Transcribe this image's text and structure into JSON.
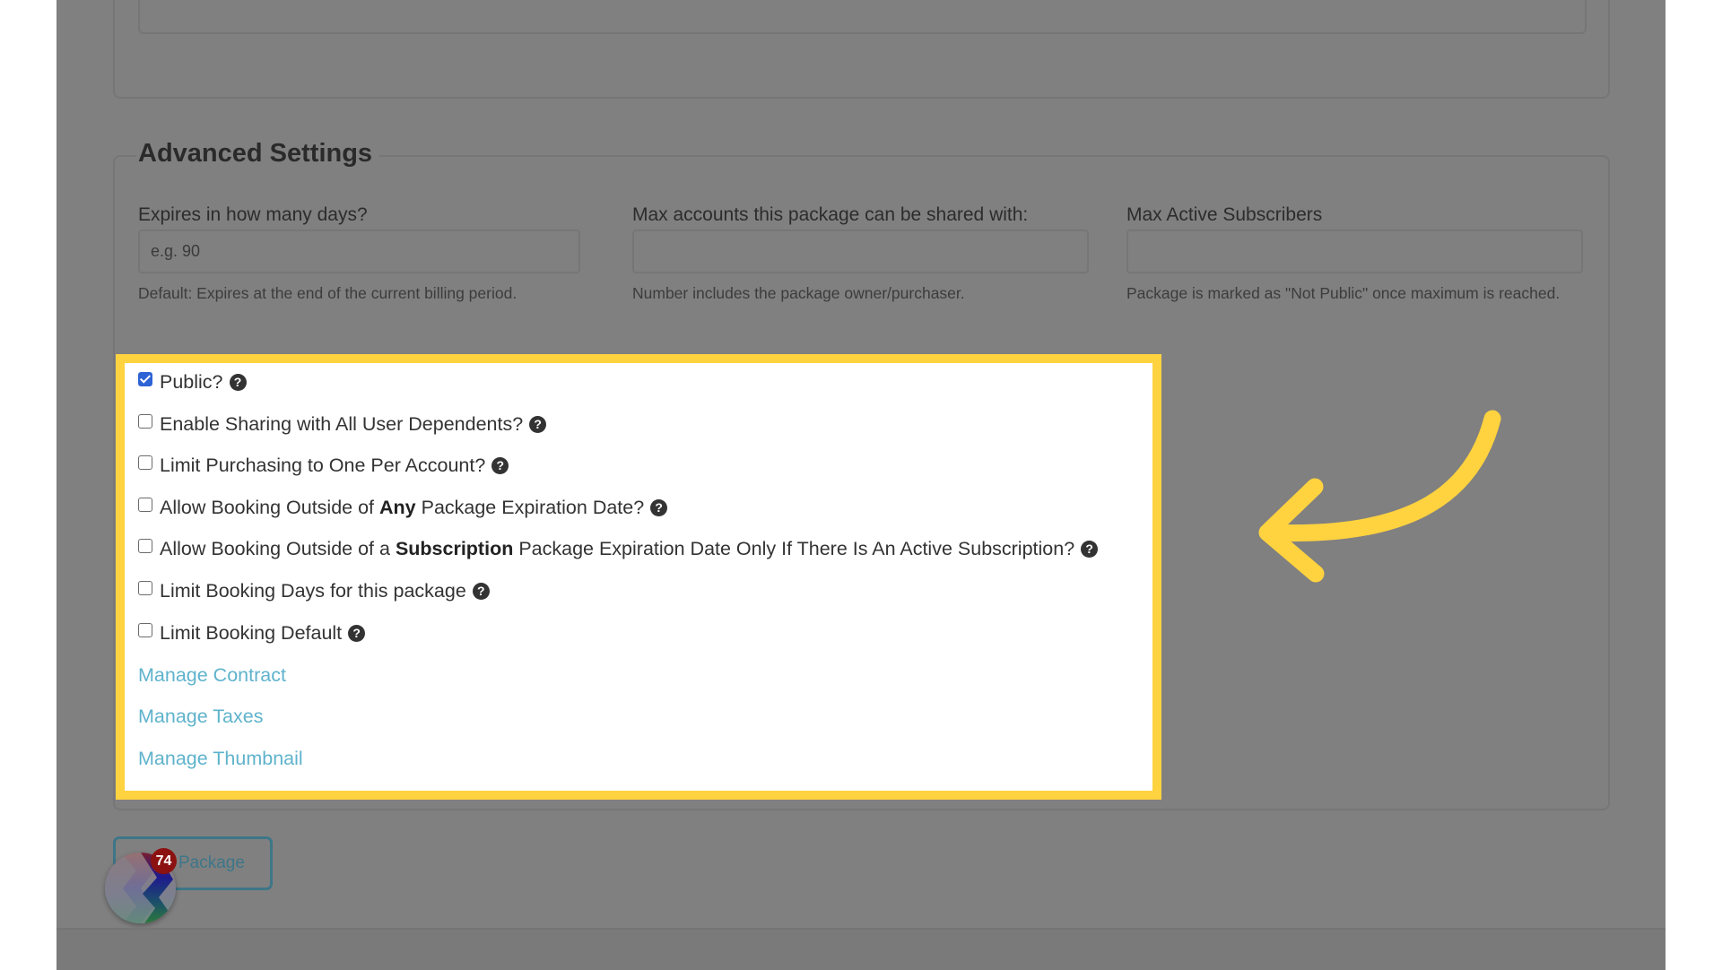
{
  "top_section": {
    "description_textarea_value": ""
  },
  "advanced_settings": {
    "legend": "Advanced Settings",
    "fields": [
      {
        "label": "Expires in how many days?",
        "value": "",
        "placeholder": "e.g. 90",
        "help": "Default: Expires at the end of the current billing period."
      },
      {
        "label": "Max accounts this package can be shared with:",
        "value": "",
        "placeholder": "",
        "help": "Number includes the package owner/purchaser."
      },
      {
        "label": "Max Active Subscribers",
        "value": "",
        "placeholder": "",
        "help": "Package is marked as \"Not Public\" once maximum is reached."
      }
    ],
    "options": [
      {
        "label": "Public?",
        "checked": true,
        "help_icon": "question-circle-icon"
      },
      {
        "label": "Enable Sharing with All User Dependents?",
        "checked": false,
        "help_icon": "question-circle-icon"
      },
      {
        "label": "Limit Purchasing to One Per Account?",
        "checked": false,
        "help_icon": "question-circle-icon"
      },
      {
        "label_pre": "Allow Booking Outside of ",
        "label_bold": "Any",
        "label_post": " Package Expiration Date?",
        "checked": false,
        "help_icon": "question-circle-icon"
      },
      {
        "label_pre": "Allow Booking Outside of a ",
        "label_bold": "Subscription",
        "label_post": " Package Expiration Date Only If There Is An Active Subscription?",
        "checked": false,
        "help_icon": "question-circle-icon"
      },
      {
        "label": "Limit Booking Days for this package",
        "checked": false,
        "help_icon": "question-circle-icon"
      },
      {
        "label": "Limit Booking Default",
        "checked": false,
        "help_icon": "question-circle-icon"
      }
    ],
    "links": [
      {
        "label": "Manage Contract"
      },
      {
        "label": "Manage Taxes"
      },
      {
        "label": "Manage Thumbnail"
      }
    ]
  },
  "actions": {
    "save_button_label": "Package"
  },
  "notification_widget": {
    "badge_count": "74",
    "icon": "app-logo-icon"
  },
  "annotation": {
    "highlight_color": "#ffd23f",
    "arrow_icon": "curved-arrow-left-icon"
  },
  "colors": {
    "overlay_gray": "#808080",
    "link": "#5fb3cc",
    "checkbox_checked": "#2e63d6",
    "badge": "#8b1210",
    "button_border": "#3d7688"
  }
}
